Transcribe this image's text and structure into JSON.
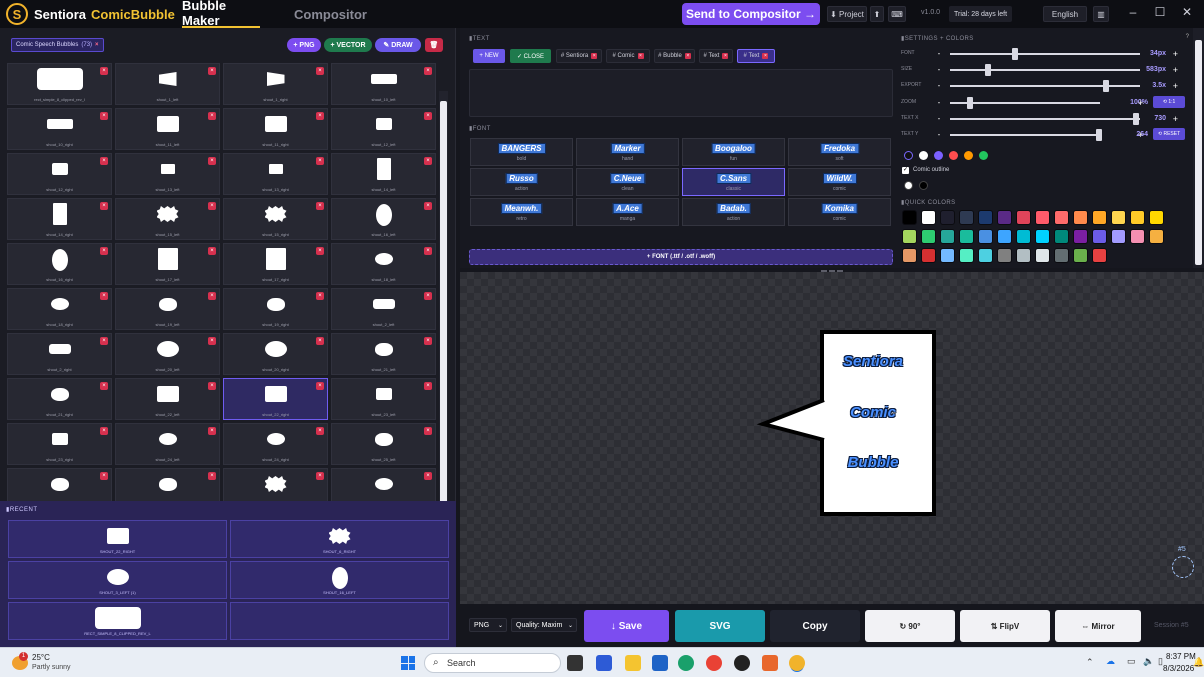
{
  "app": {
    "brand_part1": "Sentiora",
    "brand_part2": "ComicBubble",
    "accent": "#7c4df0",
    "brand_color": "#f1c232"
  },
  "tabs": [
    {
      "label": "Bubble Maker",
      "active": true
    },
    {
      "label": "Compositor",
      "active": false
    }
  ],
  "topbar": {
    "send_label": "Send to Compositor →",
    "project_label": "⬇ Project",
    "upload_label": "⬆",
    "version": "v1.0.0",
    "trial": "Trial: 28 days left",
    "language": "English"
  },
  "library": {
    "collection_chip": "Comic Speech Bubbles",
    "count": "(73)",
    "actions": {
      "png": "+ PNG",
      "vector": "+ VECTOR",
      "draw": "DRAW"
    },
    "items": [
      {
        "label": "rect_simple_8_clipped_rev_l",
        "shape": "rect",
        "selected": false
      },
      {
        "label": "shout_1_left",
        "shape": "flag-l",
        "selected": false
      },
      {
        "label": "shout_1_right",
        "shape": "flag-r",
        "selected": false
      },
      {
        "label": "shout_10_left",
        "shape": "wide",
        "selected": false
      },
      {
        "label": "shout_10_right",
        "shape": "wide",
        "selected": false
      },
      {
        "label": "shout_11_left",
        "shape": "sq",
        "selected": false
      },
      {
        "label": "shout_11_right",
        "shape": "sq",
        "selected": false
      },
      {
        "label": "shout_12_left",
        "shape": "smsq",
        "selected": false
      },
      {
        "label": "shout_12_right",
        "shape": "smsq",
        "selected": false
      },
      {
        "label": "shout_13_left",
        "shape": "tiny",
        "selected": false
      },
      {
        "label": "shout_13_right",
        "shape": "tiny",
        "selected": false
      },
      {
        "label": "shout_14_left",
        "shape": "tall",
        "selected": false
      },
      {
        "label": "shout_14_right",
        "shape": "tall",
        "selected": false
      },
      {
        "label": "shout_15_left",
        "shape": "burst",
        "selected": false
      },
      {
        "label": "shout_15_right",
        "shape": "burst",
        "selected": false
      },
      {
        "label": "shout_16_left",
        "shape": "oval-tall",
        "selected": false
      },
      {
        "label": "shout_16_right",
        "shape": "oval-tall",
        "selected": false
      },
      {
        "label": "shout_17_left",
        "shape": "big-sq",
        "selected": false
      },
      {
        "label": "shout_17_right",
        "shape": "big-sq",
        "selected": false
      },
      {
        "label": "shout_18_left",
        "shape": "oval",
        "selected": false
      },
      {
        "label": "shout_18_right",
        "shape": "oval",
        "selected": false
      },
      {
        "label": "shout_19_left",
        "shape": "cloud",
        "selected": false
      },
      {
        "label": "shout_19_right",
        "shape": "cloud",
        "selected": false
      },
      {
        "label": "shout_2_left",
        "shape": "bars",
        "selected": false
      },
      {
        "label": "shout_2_right",
        "shape": "bars",
        "selected": false
      },
      {
        "label": "shout_20_left",
        "shape": "oval-big",
        "selected": false
      },
      {
        "label": "shout_20_right",
        "shape": "oval-big",
        "selected": false
      },
      {
        "label": "shout_21_left",
        "shape": "cloud",
        "selected": false
      },
      {
        "label": "shout_21_right",
        "shape": "cloud",
        "selected": false
      },
      {
        "label": "shout_22_left",
        "shape": "sq",
        "selected": false
      },
      {
        "label": "shout_22_right",
        "shape": "sq",
        "selected": true
      },
      {
        "label": "shout_23_left",
        "shape": "smsq",
        "selected": false
      },
      {
        "label": "shout_23_right",
        "shape": "smsq",
        "selected": false
      },
      {
        "label": "shout_24_left",
        "shape": "oval",
        "selected": false
      },
      {
        "label": "shout_24_right",
        "shape": "oval",
        "selected": false
      },
      {
        "label": "shout_25_left",
        "shape": "cloud",
        "selected": false
      },
      {
        "label": "",
        "shape": "cloud",
        "selected": false
      },
      {
        "label": "",
        "shape": "cloud",
        "selected": false
      },
      {
        "label": "",
        "shape": "burst",
        "selected": false
      },
      {
        "label": "",
        "shape": "oval",
        "selected": false
      }
    ]
  },
  "recent": {
    "title": "RECENT",
    "items": [
      {
        "label": "SHOUT_22_RIGHT",
        "shape": "sq"
      },
      {
        "label": "SHOUT_6_RIGHT",
        "shape": "burst"
      },
      {
        "label": "SHOUT_3_LEFT (1)",
        "shape": "oval-big"
      },
      {
        "label": "SHOUT_16_LEFT",
        "shape": "oval-tall"
      },
      {
        "label": "RECT_SIMPLE_8_CLIPPED_REV_L",
        "shape": "rect"
      }
    ]
  },
  "text_panel": {
    "title": "TEXT",
    "new_label": "+ NEW",
    "close_label": "✓ CLOSE",
    "layers": [
      "# Sentiora",
      "# Comic",
      "# Bubble",
      "# Text",
      "# Text"
    ],
    "active_layer_index": 4,
    "font_title": "FONT",
    "fonts": [
      {
        "name": "BANGERS",
        "desc": "bold"
      },
      {
        "name": "Marker",
        "desc": "hand"
      },
      {
        "name": "Boogaloo",
        "desc": "fun"
      },
      {
        "name": "Fredoka",
        "desc": "soft"
      },
      {
        "name": "Russo",
        "desc": "action"
      },
      {
        "name": "C.Neue",
        "desc": "clean"
      },
      {
        "name": "C.Sans",
        "desc": "classic"
      },
      {
        "name": "WildW.",
        "desc": "comic"
      },
      {
        "name": "Meanwh.",
        "desc": "retro"
      },
      {
        "name": "A.Ace",
        "desc": "manga"
      },
      {
        "name": "Badab.",
        "desc": "action"
      },
      {
        "name": "Komika",
        "desc": "comic"
      }
    ],
    "selected_font_index": 6,
    "upload_label": "+ FONT (.ttf / .otf / .woff)"
  },
  "settings": {
    "title": "SETTINGS + COLORS",
    "help": "?",
    "sliders": [
      {
        "label": "FONT",
        "value": "34px",
        "level": 0.34
      },
      {
        "label": "SIZE",
        "value": "583px",
        "level": 0.2
      },
      {
        "label": "EXPORT",
        "value": "3.5x",
        "level": 0.82
      },
      {
        "label": "ZOOM",
        "value": "100%",
        "level": 0.13
      },
      {
        "label": "TEXT X",
        "value": "730",
        "level": 0.98
      },
      {
        "label": "TEXT Y",
        "value": "264",
        "level": 0.98
      }
    ],
    "zoom_reset": "⟲ 1:1",
    "pos_reset": "⟲ RESET",
    "text_colors": [
      "#111111",
      "#ffffff",
      "#7b61ff",
      "#ff4d4f",
      "#ff9900",
      "#22c55e"
    ],
    "outline_label": "Comic outline",
    "outline_colors": [
      "#ffffff",
      "#000000"
    ],
    "quick_title": "QUICK COLORS",
    "quick_colors": [
      "#000000",
      "#ffffff",
      "#1f1f2e",
      "#2e3a52",
      "#1c3a6e",
      "#5a2a86",
      "#e0445a",
      "#ff5a6a",
      "#ff6b6b",
      "#ff8a4c",
      "#ffa726",
      "#ffd54f",
      "#ffca28",
      "#ffd700",
      "#a4d65e",
      "#2ecc71",
      "#26a69a",
      "#1abc9c",
      "#4a90e2",
      "#3da5ff",
      "#00bcd4",
      "#00d2ff",
      "#00897b",
      "#7b1fa2",
      "#6c5ce7",
      "#a29bfe",
      "#f48fb1",
      "#f5b041",
      "#e59866",
      "#d63031",
      "#74b9ff",
      "#55efc4",
      "#4dd0e1",
      "#808080",
      "#b2bec3",
      "#dfe6e9",
      "#636e72",
      "#6ab04c",
      "#e84141"
    ]
  },
  "canvas": {
    "lines": [
      "Sentiora",
      "Comic",
      "Bubble"
    ],
    "session_badge": "#5"
  },
  "bottom": {
    "format": "PNG",
    "quality": "Quality: Maxim",
    "save": "↓ Save",
    "svg": "SVG",
    "copy": "Copy",
    "rotate": "↻ 90°",
    "flipv": "⇅ FlipV",
    "mirror": "⇔ Mirror",
    "session": "Session #5"
  },
  "taskbar": {
    "temp": "25°C",
    "weather": "Partly sunny",
    "search_placeholder": "Search",
    "time": "8:37 PM",
    "date": "8/3/2026",
    "badge": "1"
  }
}
